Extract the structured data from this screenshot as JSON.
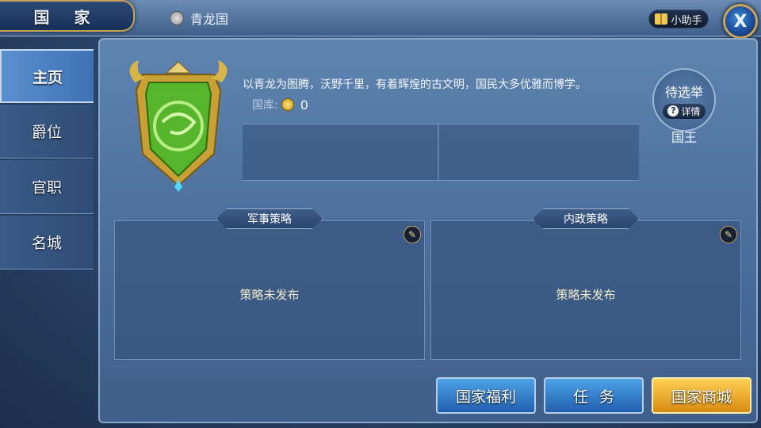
{
  "header": {
    "title": "国 家",
    "country_name": "青龙国",
    "helper_label": "小助手",
    "close_label": "X"
  },
  "sidebar": {
    "items": [
      {
        "label": "主页",
        "active": true
      },
      {
        "label": "爵位",
        "active": false
      },
      {
        "label": "官职",
        "active": false
      },
      {
        "label": "名城",
        "active": false
      }
    ]
  },
  "main": {
    "description": "以青龙为图腾，沃野千里，有着辉煌的古文明，国民大多优雅而博学。",
    "treasury_label": "国库:",
    "treasury_value": "0",
    "king": {
      "status": "待选举",
      "detail_label": "详情",
      "role": "国王"
    },
    "military": {
      "title": "军事策略",
      "empty_text": "策略未发布"
    },
    "civil": {
      "title": "内政策略",
      "empty_text": "策略未发布"
    }
  },
  "buttons": {
    "welfare": "国家福利",
    "task": "任务",
    "shop": "国家商城"
  },
  "colors": {
    "accent_gold": "#c9a35a",
    "emblem_green": "#5fbf2a",
    "button_blue": "#1f5fae",
    "button_gold": "#d88a10"
  }
}
